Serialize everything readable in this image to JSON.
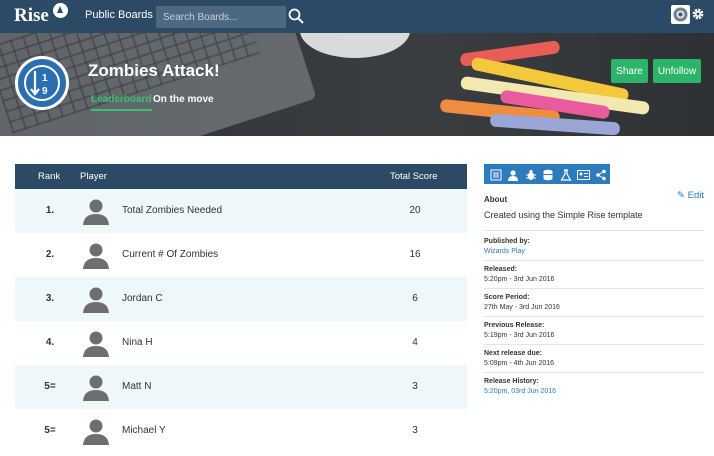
{
  "app": {
    "logo": "Rise",
    "nav_link": "Public Boards"
  },
  "search": {
    "placeholder": "Search Boards..."
  },
  "colors": {
    "nav": "#2c4a66",
    "accent_green": "#2bb46a",
    "link_blue": "#2c7bbd",
    "alt_row": "#eef7f9"
  },
  "board": {
    "title": "Zombies Attack!",
    "tabs": [
      "Leaderboard",
      "On the move"
    ],
    "icon": "rank-1-9-icon",
    "share_label": "Share",
    "unfollow_label": "Unfollow"
  },
  "table": {
    "headers": {
      "rank": "Rank",
      "player": "Player",
      "score": "Total Score"
    },
    "rows": [
      {
        "rank": "1.",
        "player": "Total Zombies Needed",
        "score": "20"
      },
      {
        "rank": "2.",
        "player": "Current # Of Zombies",
        "score": "16"
      },
      {
        "rank": "3.",
        "player": "Jordan C",
        "score": "6"
      },
      {
        "rank": "4.",
        "player": "Nina H",
        "score": "4"
      },
      {
        "rank": "5=",
        "player": "Matt N",
        "score": "3"
      },
      {
        "rank": "5=",
        "player": "Michael Y",
        "score": "3"
      }
    ]
  },
  "sidebar": {
    "icons": [
      "list-icon",
      "user-icon",
      "bug-icon",
      "database-icon",
      "flask-icon",
      "id-card-icon",
      "share-icon"
    ],
    "edit_label": "Edit",
    "about_heading": "About",
    "about_text": "Created using the Simple Rise template",
    "published_by_h": "Published by:",
    "published_by_v": "Wizards Play",
    "released_h": "Released:",
    "released_v": "5:20pm - 3rd Jun 2016",
    "score_period_h": "Score Period:",
    "score_period_v": "27th May - 3rd Jun 2016",
    "previous_release_h": "Previous Release:",
    "previous_release_v": "5:19pm - 3rd Jun 2016",
    "next_release_h": "Next release due:",
    "next_release_v": "5:09pm - 4th Jun 2016",
    "release_history_h": "Release History:",
    "release_history_v": "5:20pm, 03rd Jun 2016"
  }
}
